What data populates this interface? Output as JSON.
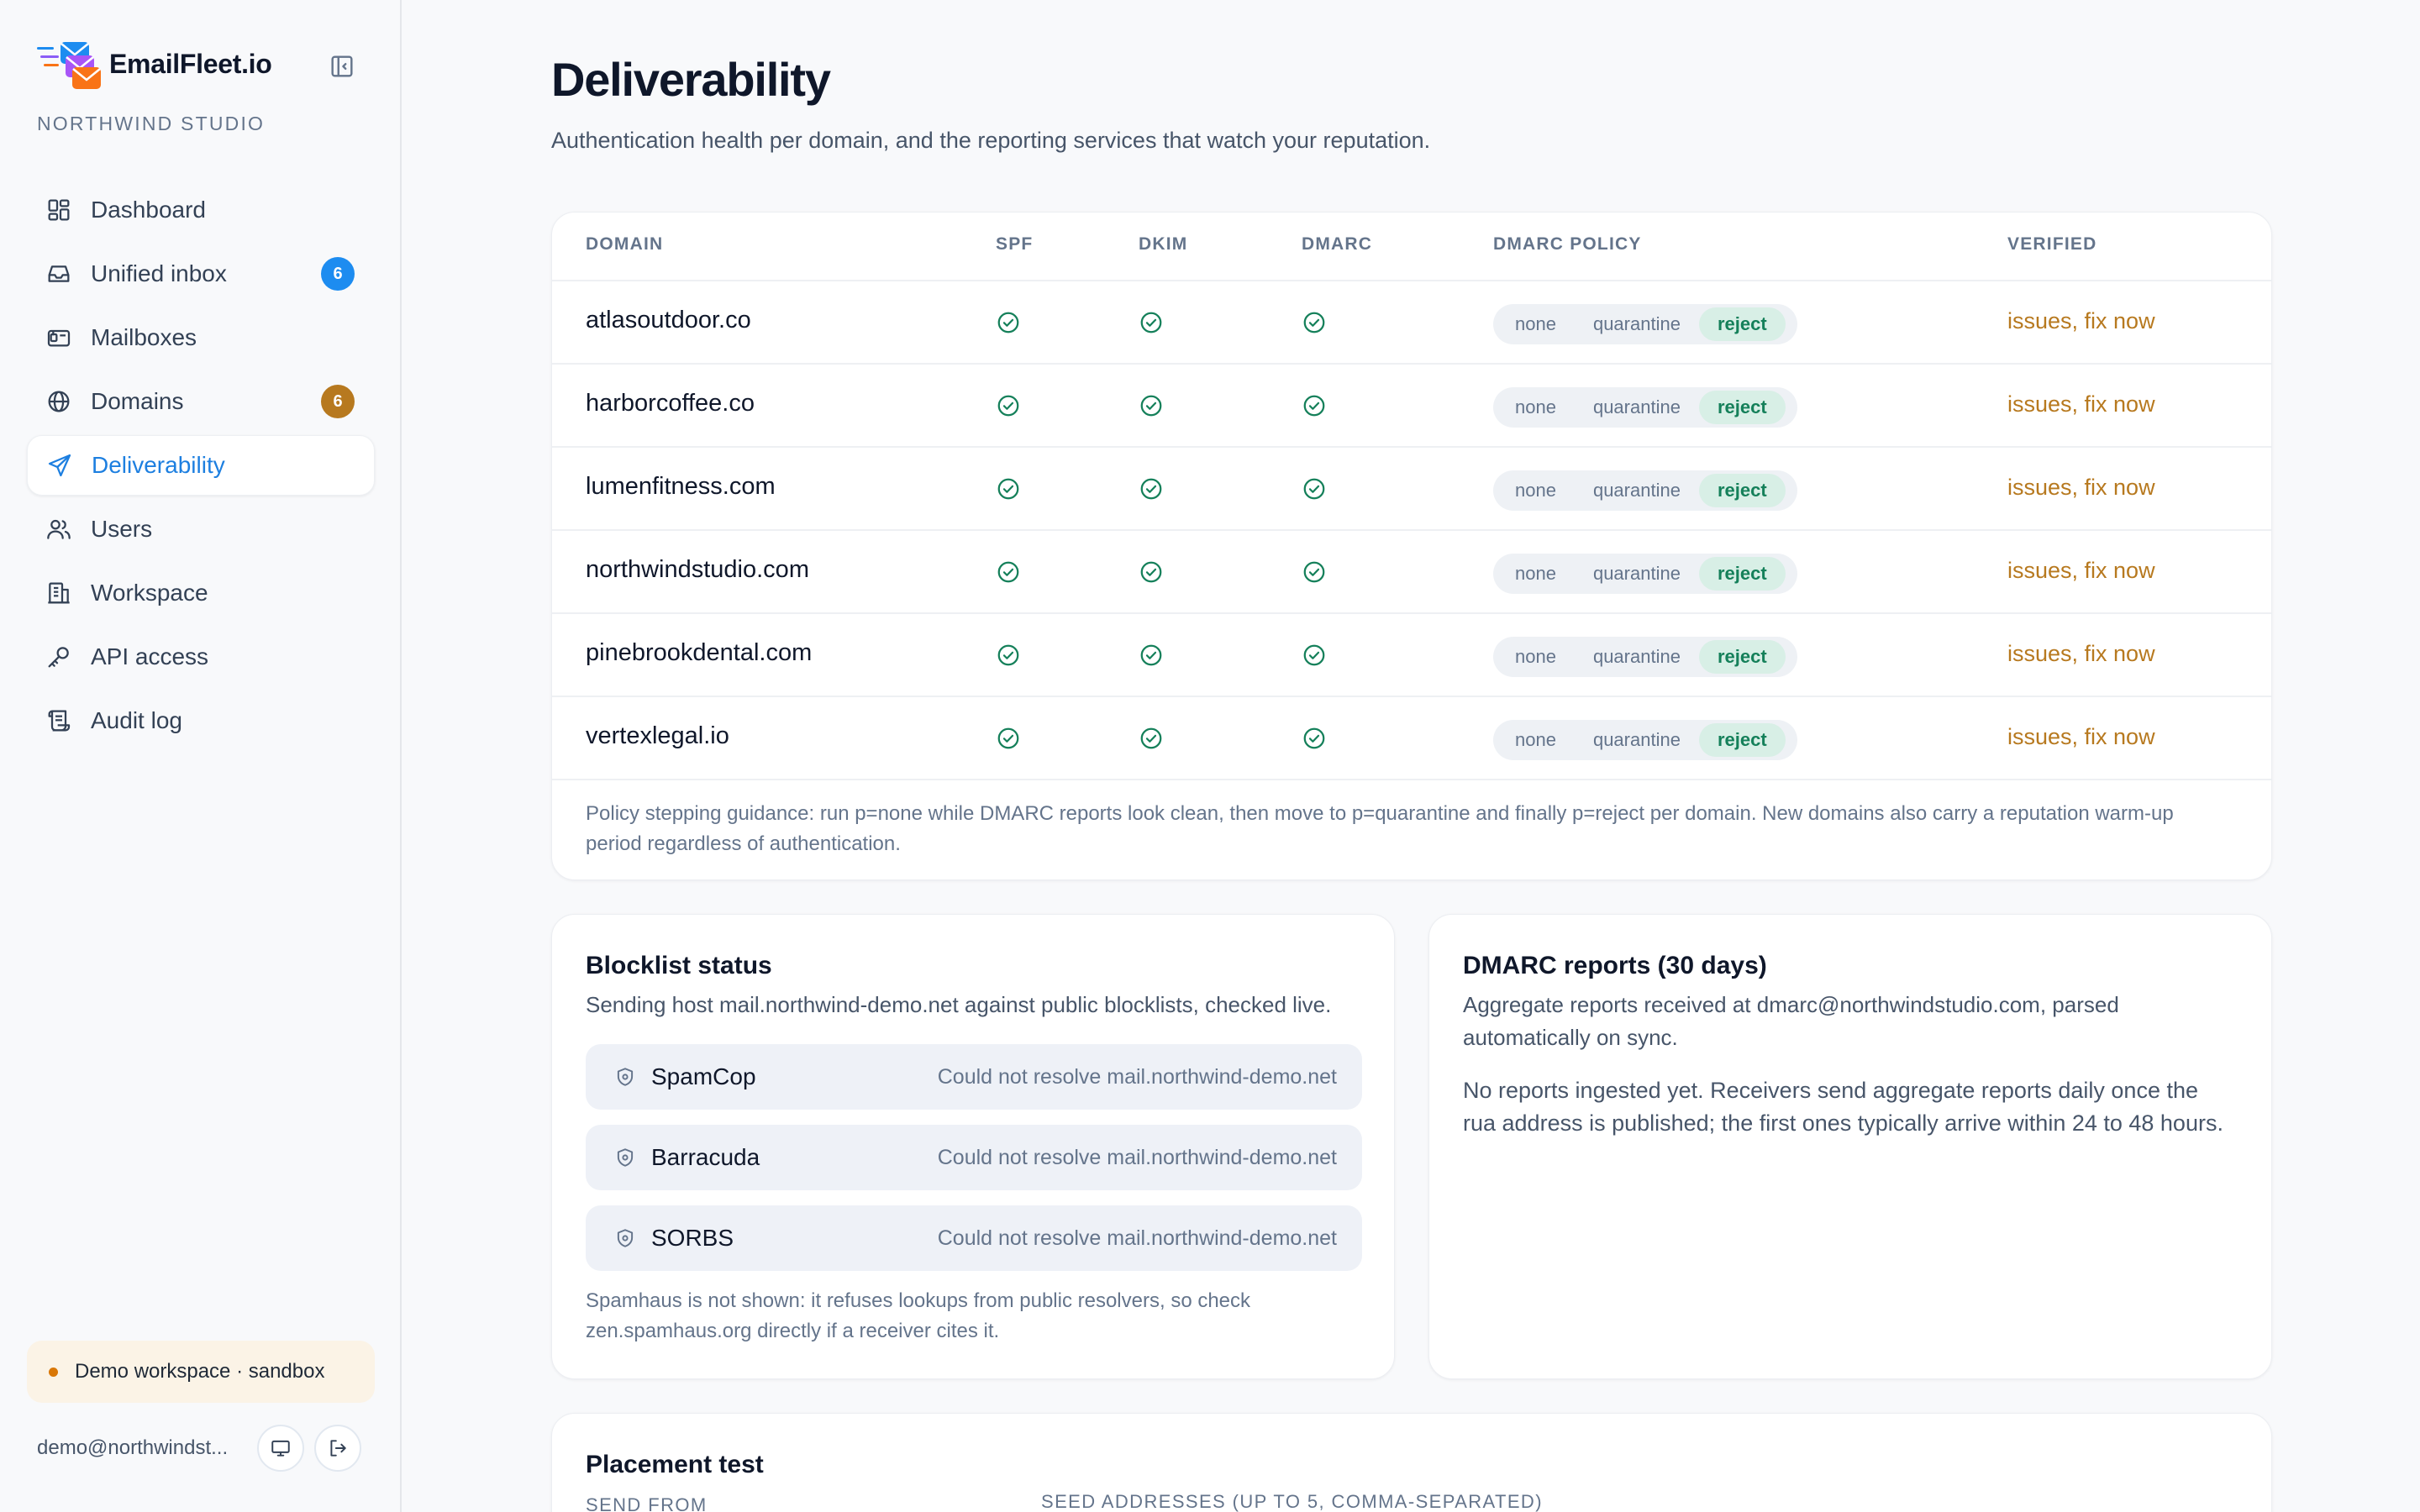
{
  "brand": {
    "name": "EmailFleet.io",
    "org": "NORTHWIND STUDIO"
  },
  "nav": [
    {
      "label": "Dashboard",
      "icon": "dashboard-icon"
    },
    {
      "label": "Unified inbox",
      "icon": "inbox-icon",
      "badge": "6"
    },
    {
      "label": "Mailboxes",
      "icon": "mailbox-icon"
    },
    {
      "label": "Domains",
      "icon": "globe-icon",
      "badge": "6"
    },
    {
      "label": "Deliverability",
      "icon": "send-icon",
      "active": true
    },
    {
      "label": "Users",
      "icon": "users-icon"
    },
    {
      "label": "Workspace",
      "icon": "building-icon"
    },
    {
      "label": "API access",
      "icon": "key-icon"
    },
    {
      "label": "Audit log",
      "icon": "scroll-icon"
    }
  ],
  "demo_banner": "Demo workspace · sandbox",
  "user_email": "demo@northwindst...",
  "page": {
    "title": "Deliverability",
    "subtitle": "Authentication health per domain, and the reporting services that watch your reputation."
  },
  "table": {
    "headers": {
      "domain": "DOMAIN",
      "spf": "SPF",
      "dkim": "DKIM",
      "dmarc": "DMARC",
      "policy": "DMARC POLICY",
      "verified": "VERIFIED"
    },
    "policy_options": [
      "none",
      "quarantine",
      "reject"
    ],
    "rows": [
      {
        "domain": "atlasoutdoor.co",
        "policy": "reject",
        "verified": "issues, fix now"
      },
      {
        "domain": "harborcoffee.co",
        "policy": "reject",
        "verified": "issues, fix now"
      },
      {
        "domain": "lumenfitness.com",
        "policy": "reject",
        "verified": "issues, fix now"
      },
      {
        "domain": "northwindstudio.com",
        "policy": "reject",
        "verified": "issues, fix now"
      },
      {
        "domain": "pinebrookdental.com",
        "policy": "reject",
        "verified": "issues, fix now"
      },
      {
        "domain": "vertexlegal.io",
        "policy": "reject",
        "verified": "issues, fix now"
      }
    ],
    "guidance": "Policy stepping guidance: run p=none while DMARC reports look clean, then move to p=quarantine and finally p=reject per domain. New domains also carry a reputation warm-up period regardless of authentication."
  },
  "blocklist": {
    "title": "Blocklist status",
    "description": "Sending host mail.northwind-demo.net against public blocklists, checked live.",
    "items": [
      {
        "name": "SpamCop",
        "status": "Could not resolve mail.northwind-demo.net"
      },
      {
        "name": "Barracuda",
        "status": "Could not resolve mail.northwind-demo.net"
      },
      {
        "name": "SORBS",
        "status": "Could not resolve mail.northwind-demo.net"
      }
    ],
    "note": "Spamhaus is not shown: it refuses lookups from public resolvers, so check zen.spamhaus.org directly if a receiver cites it."
  },
  "dmarc_reports": {
    "title": "DMARC reports (30 days)",
    "description": "Aggregate reports received at dmarc@northwindstudio.com, parsed automatically on sync.",
    "empty": "No reports ingested yet. Receivers send aggregate reports daily once the rua address is published; the first ones typically arrive within 24 to 48 hours."
  },
  "placement": {
    "title": "Placement test",
    "send_from_label": "SEND FROM",
    "seeds_label": "SEED ADDRESSES (UP TO 5, COMMA-SEPARATED)"
  },
  "colors": {
    "accent": "#1d7fe0",
    "success": "#15805a",
    "warning": "#b7791f"
  }
}
